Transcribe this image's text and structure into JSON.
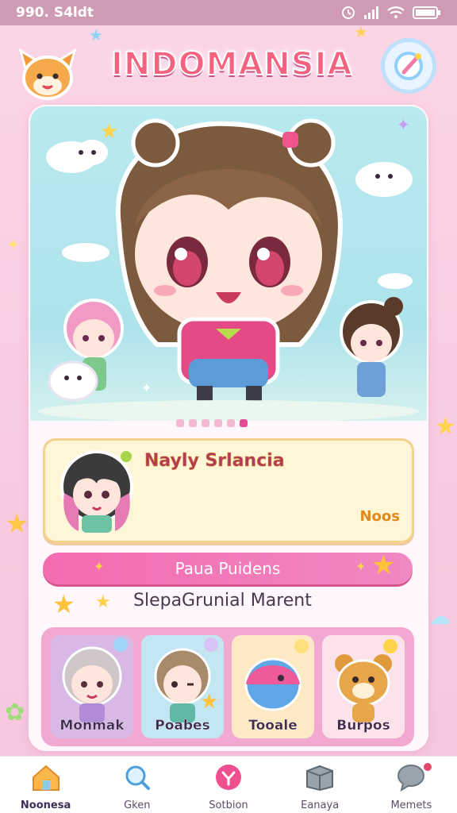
{
  "status": {
    "left": "990. S4ldt",
    "right_icons": [
      "alarm-icon",
      "signal-icon",
      "wifi-icon",
      "battery-icon"
    ]
  },
  "header": {
    "title": "INDOMANSIA",
    "logo_icon": "fox-mascot-icon",
    "action_icon": "magic-wand-icon"
  },
  "hero": {
    "carousel_count": 6,
    "active_index": 5
  },
  "featured": {
    "title": "Nayly Srlancia",
    "more": "Noos"
  },
  "pill": {
    "label": "Paua Puidens"
  },
  "subtitle": "SlepaGrunial Marent",
  "categories": [
    {
      "label": "Monmak"
    },
    {
      "label": "Poabes"
    },
    {
      "label": "Tooale"
    },
    {
      "label": "Burpos"
    }
  ],
  "tabs": [
    {
      "label": "Noonesa",
      "icon": "home-icon",
      "active": true
    },
    {
      "label": "Gken",
      "icon": "search-icon",
      "active": false
    },
    {
      "label": "Sotbion",
      "icon": "heart-icon",
      "active": false
    },
    {
      "label": "Eanaya",
      "icon": "box-icon",
      "active": false
    },
    {
      "label": "Memets",
      "icon": "chat-icon",
      "active": false
    }
  ],
  "colors": {
    "accent": "#e54b95",
    "pill": "#f46bb0",
    "featured_bg": "#fff6d8"
  }
}
